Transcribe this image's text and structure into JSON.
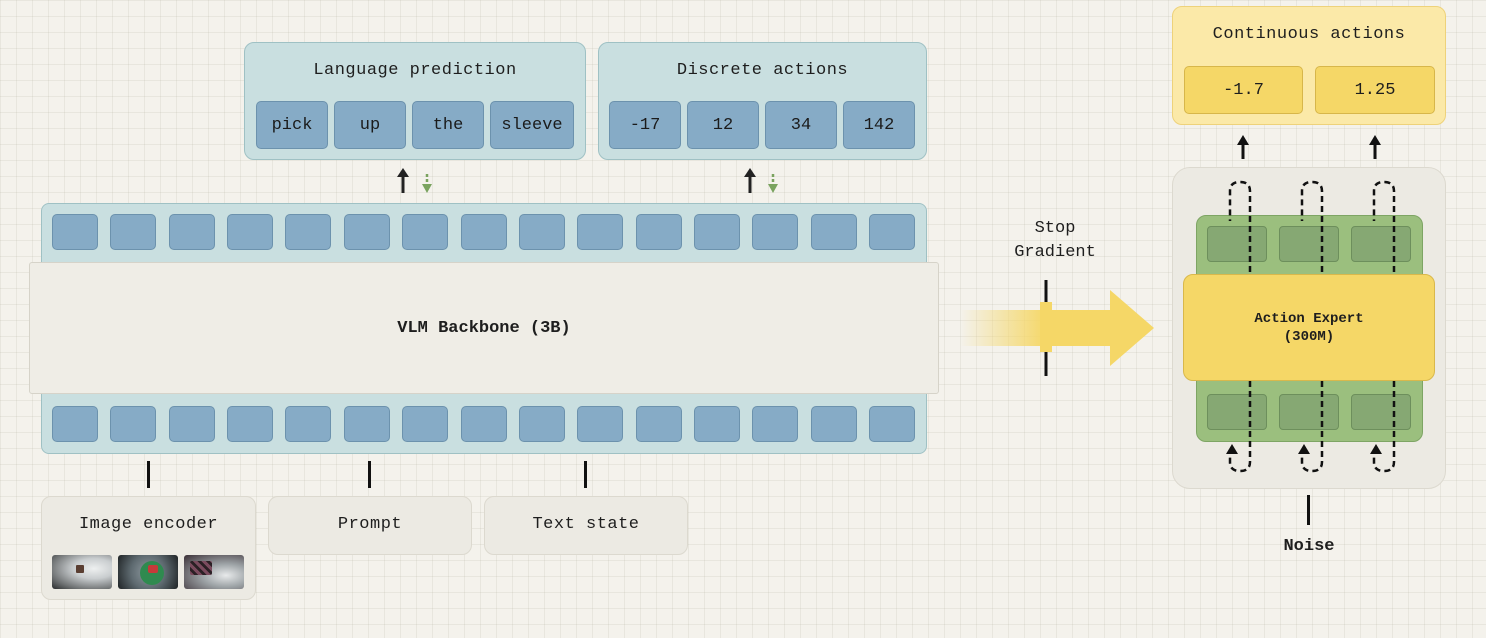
{
  "language_prediction": {
    "title": "Language prediction",
    "tokens": [
      "pick",
      "up",
      "the",
      "sleeve"
    ]
  },
  "discrete_actions": {
    "title": "Discrete actions",
    "tokens": [
      "-17",
      "12",
      "34",
      "142"
    ]
  },
  "continuous_actions": {
    "title": "Continuous actions",
    "tokens": [
      "-1.7",
      "1.25"
    ]
  },
  "backbone": {
    "label": "VLM Backbone (3B)"
  },
  "stop_gradient": {
    "line1": "Stop",
    "line2": "Gradient"
  },
  "action_expert": {
    "line1": "Action Expert",
    "line2": "(300M)"
  },
  "inputs": {
    "image_encoder": "Image encoder",
    "prompt": "Prompt",
    "text_state": "Text state"
  },
  "noise": {
    "label": "Noise"
  },
  "colors": {
    "token_blue": "#86abc6",
    "panel_blue": "#c9dfe0",
    "expert_yellow": "#f5d767",
    "expert_green": "#86a873",
    "gradient_arrow_green": "#7aa35f"
  }
}
